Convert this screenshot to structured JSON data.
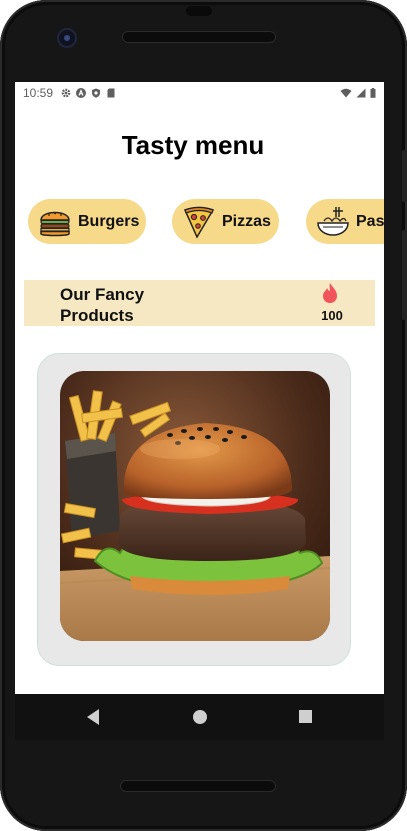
{
  "status_bar": {
    "time": "10:59",
    "left_icons": [
      "gear-icon",
      "a-icon",
      "shield-icon",
      "sd-card-icon"
    ],
    "right_icons": [
      "wifi-icon",
      "signal-icon",
      "battery-icon"
    ]
  },
  "header": {
    "title": "Tasty menu"
  },
  "categories": [
    {
      "label": "Burgers",
      "icon": "burger-icon"
    },
    {
      "label": "Pizzas",
      "icon": "pizza-icon"
    },
    {
      "label": "Pas",
      "icon": "pasta-icon"
    }
  ],
  "products_header": {
    "title": "Our Fancy Products",
    "count": "100",
    "icon": "flame-icon"
  },
  "product_card": {
    "image": "burger-with-fries-photo"
  },
  "nav_bar": {
    "buttons": [
      "back-icon",
      "home-icon",
      "recents-icon"
    ]
  },
  "colors": {
    "category_bg": "#f7d98a",
    "products_header_bg": "#f5e8c3",
    "card_bg": "#e8e8e8",
    "flame": "#f2545b"
  }
}
